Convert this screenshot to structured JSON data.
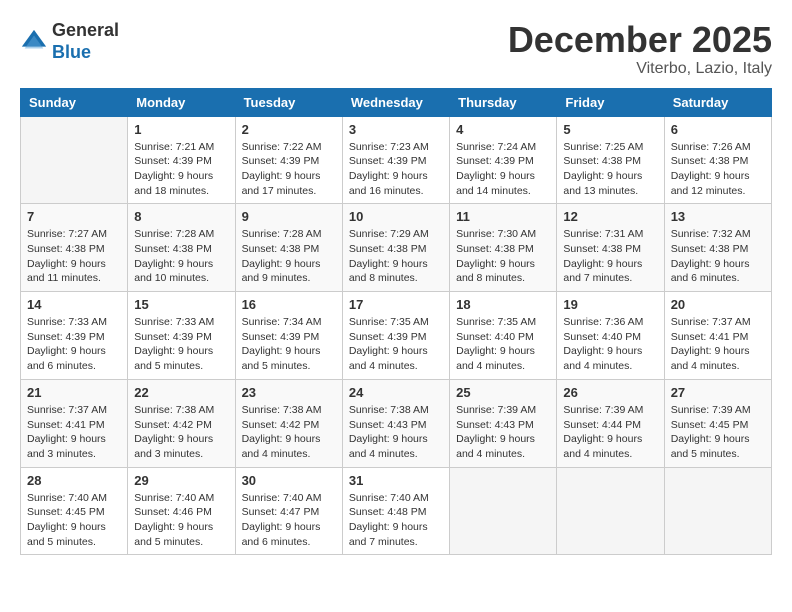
{
  "logo": {
    "general": "General",
    "blue": "Blue"
  },
  "header": {
    "month": "December 2025",
    "location": "Viterbo, Lazio, Italy"
  },
  "days_of_week": [
    "Sunday",
    "Monday",
    "Tuesday",
    "Wednesday",
    "Thursday",
    "Friday",
    "Saturday"
  ],
  "weeks": [
    [
      {
        "day": "",
        "info": ""
      },
      {
        "day": "1",
        "info": "Sunrise: 7:21 AM\nSunset: 4:39 PM\nDaylight: 9 hours\nand 18 minutes."
      },
      {
        "day": "2",
        "info": "Sunrise: 7:22 AM\nSunset: 4:39 PM\nDaylight: 9 hours\nand 17 minutes."
      },
      {
        "day": "3",
        "info": "Sunrise: 7:23 AM\nSunset: 4:39 PM\nDaylight: 9 hours\nand 16 minutes."
      },
      {
        "day": "4",
        "info": "Sunrise: 7:24 AM\nSunset: 4:39 PM\nDaylight: 9 hours\nand 14 minutes."
      },
      {
        "day": "5",
        "info": "Sunrise: 7:25 AM\nSunset: 4:38 PM\nDaylight: 9 hours\nand 13 minutes."
      },
      {
        "day": "6",
        "info": "Sunrise: 7:26 AM\nSunset: 4:38 PM\nDaylight: 9 hours\nand 12 minutes."
      }
    ],
    [
      {
        "day": "7",
        "info": "Sunrise: 7:27 AM\nSunset: 4:38 PM\nDaylight: 9 hours\nand 11 minutes."
      },
      {
        "day": "8",
        "info": "Sunrise: 7:28 AM\nSunset: 4:38 PM\nDaylight: 9 hours\nand 10 minutes."
      },
      {
        "day": "9",
        "info": "Sunrise: 7:28 AM\nSunset: 4:38 PM\nDaylight: 9 hours\nand 9 minutes."
      },
      {
        "day": "10",
        "info": "Sunrise: 7:29 AM\nSunset: 4:38 PM\nDaylight: 9 hours\nand 8 minutes."
      },
      {
        "day": "11",
        "info": "Sunrise: 7:30 AM\nSunset: 4:38 PM\nDaylight: 9 hours\nand 8 minutes."
      },
      {
        "day": "12",
        "info": "Sunrise: 7:31 AM\nSunset: 4:38 PM\nDaylight: 9 hours\nand 7 minutes."
      },
      {
        "day": "13",
        "info": "Sunrise: 7:32 AM\nSunset: 4:38 PM\nDaylight: 9 hours\nand 6 minutes."
      }
    ],
    [
      {
        "day": "14",
        "info": "Sunrise: 7:33 AM\nSunset: 4:39 PM\nDaylight: 9 hours\nand 6 minutes."
      },
      {
        "day": "15",
        "info": "Sunrise: 7:33 AM\nSunset: 4:39 PM\nDaylight: 9 hours\nand 5 minutes."
      },
      {
        "day": "16",
        "info": "Sunrise: 7:34 AM\nSunset: 4:39 PM\nDaylight: 9 hours\nand 5 minutes."
      },
      {
        "day": "17",
        "info": "Sunrise: 7:35 AM\nSunset: 4:39 PM\nDaylight: 9 hours\nand 4 minutes."
      },
      {
        "day": "18",
        "info": "Sunrise: 7:35 AM\nSunset: 4:40 PM\nDaylight: 9 hours\nand 4 minutes."
      },
      {
        "day": "19",
        "info": "Sunrise: 7:36 AM\nSunset: 4:40 PM\nDaylight: 9 hours\nand 4 minutes."
      },
      {
        "day": "20",
        "info": "Sunrise: 7:37 AM\nSunset: 4:41 PM\nDaylight: 9 hours\nand 4 minutes."
      }
    ],
    [
      {
        "day": "21",
        "info": "Sunrise: 7:37 AM\nSunset: 4:41 PM\nDaylight: 9 hours\nand 3 minutes."
      },
      {
        "day": "22",
        "info": "Sunrise: 7:38 AM\nSunset: 4:42 PM\nDaylight: 9 hours\nand 3 minutes."
      },
      {
        "day": "23",
        "info": "Sunrise: 7:38 AM\nSunset: 4:42 PM\nDaylight: 9 hours\nand 4 minutes."
      },
      {
        "day": "24",
        "info": "Sunrise: 7:38 AM\nSunset: 4:43 PM\nDaylight: 9 hours\nand 4 minutes."
      },
      {
        "day": "25",
        "info": "Sunrise: 7:39 AM\nSunset: 4:43 PM\nDaylight: 9 hours\nand 4 minutes."
      },
      {
        "day": "26",
        "info": "Sunrise: 7:39 AM\nSunset: 4:44 PM\nDaylight: 9 hours\nand 4 minutes."
      },
      {
        "day": "27",
        "info": "Sunrise: 7:39 AM\nSunset: 4:45 PM\nDaylight: 9 hours\nand 5 minutes."
      }
    ],
    [
      {
        "day": "28",
        "info": "Sunrise: 7:40 AM\nSunset: 4:45 PM\nDaylight: 9 hours\nand 5 minutes."
      },
      {
        "day": "29",
        "info": "Sunrise: 7:40 AM\nSunset: 4:46 PM\nDaylight: 9 hours\nand 5 minutes."
      },
      {
        "day": "30",
        "info": "Sunrise: 7:40 AM\nSunset: 4:47 PM\nDaylight: 9 hours\nand 6 minutes."
      },
      {
        "day": "31",
        "info": "Sunrise: 7:40 AM\nSunset: 4:48 PM\nDaylight: 9 hours\nand 7 minutes."
      },
      {
        "day": "",
        "info": ""
      },
      {
        "day": "",
        "info": ""
      },
      {
        "day": "",
        "info": ""
      }
    ]
  ]
}
